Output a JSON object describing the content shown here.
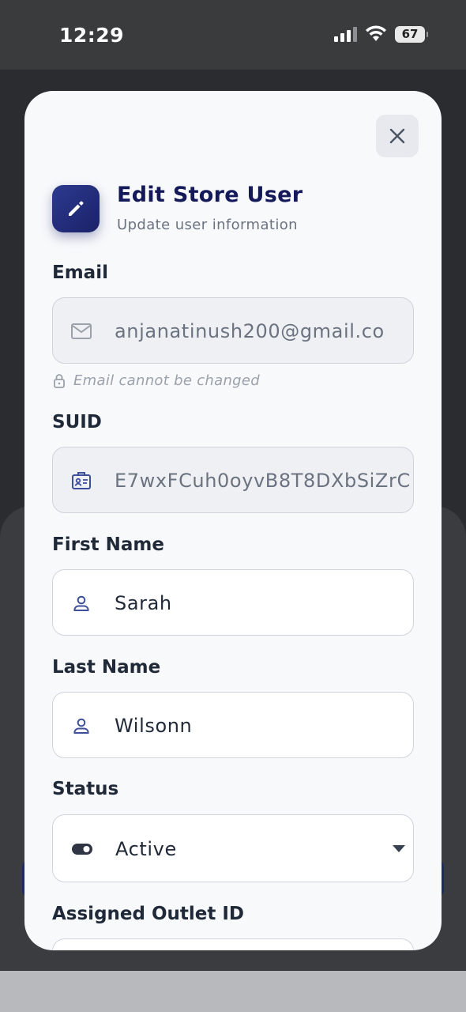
{
  "status_bar": {
    "time": "12:29",
    "battery": "67"
  },
  "modal": {
    "title": "Edit Store User",
    "subtitle": "Update user information",
    "icons": {
      "header": "pencil-icon",
      "close": "close-icon"
    }
  },
  "fields": {
    "email": {
      "label": "Email",
      "value": "anjanatinush200@gmail.co",
      "helper": "Email cannot be changed",
      "icon": "mail-icon"
    },
    "suid": {
      "label": "SUID",
      "value": "E7wxFCuh0oyvB8T8DXbSiZrC",
      "icon": "id-card-icon"
    },
    "first_name": {
      "label": "First Name",
      "value": "Sarah",
      "icon": "user-icon"
    },
    "last_name": {
      "label": "Last Name",
      "value": "Wilsonn",
      "icon": "user-icon"
    },
    "status": {
      "label": "Status",
      "value": "Active",
      "icon": "toggle-icon"
    },
    "outlet": {
      "label": "Assigned Outlet ID"
    }
  },
  "colors": {
    "accent": "#1a2168",
    "title": "#14195a"
  }
}
